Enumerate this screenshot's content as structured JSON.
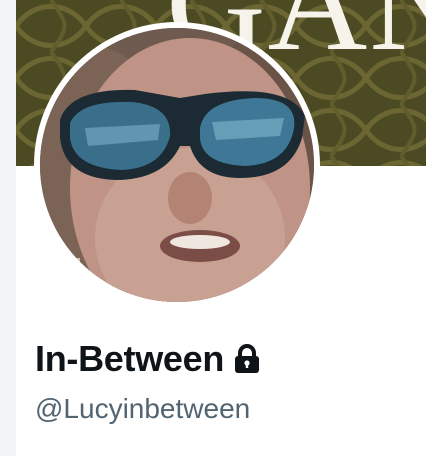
{
  "profile": {
    "banner_text": "GAN",
    "display_name": "In-Between",
    "handle": "@Lucyinbetween",
    "protected_icon": "lock-icon"
  },
  "colors": {
    "banner_background": "#4c4a22",
    "name_text": "#0f1419",
    "handle_text": "#536471"
  }
}
